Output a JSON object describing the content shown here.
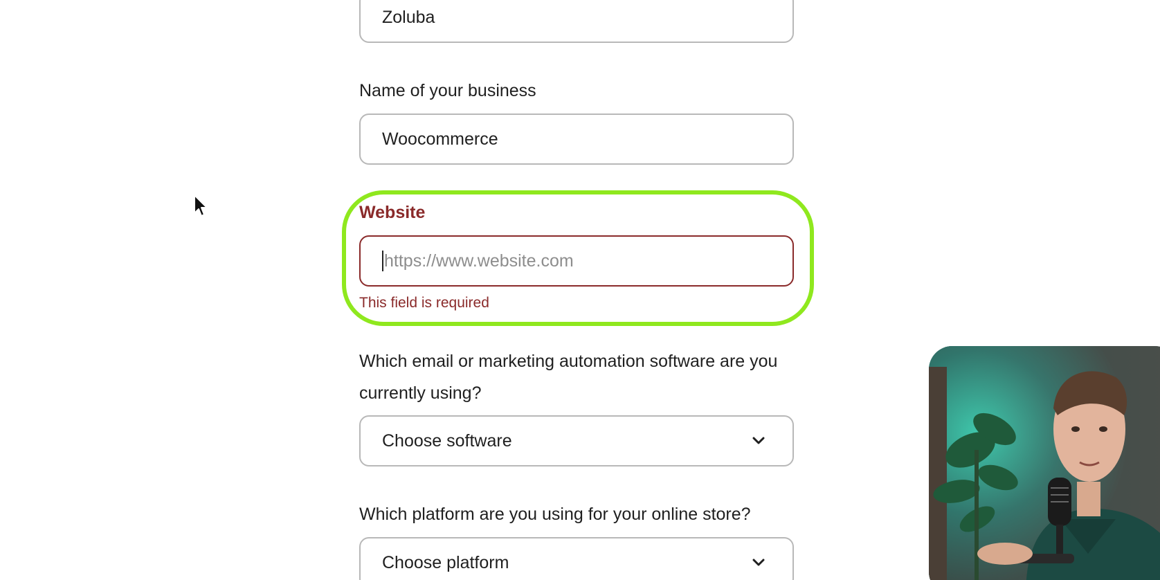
{
  "form": {
    "first_field_value": "Zoluba",
    "business_label": "Name of your business",
    "business_value": "Woocommerce",
    "website_label": "Website",
    "website_placeholder": "https://www.website.com",
    "website_error": "This field is required",
    "software_label": "Which email or marketing automation software are you currently using?",
    "software_select": "Choose software",
    "platform_label": "Which platform are you using for your online store?",
    "platform_select": "Choose platform"
  },
  "colors": {
    "error": "#8a2a2a",
    "highlight": "#8fe81e",
    "border": "#b8b8b8"
  },
  "icons": {
    "select_chevron": "chevron-down-icon",
    "mouse_cursor": "mouse-pointer-icon"
  }
}
